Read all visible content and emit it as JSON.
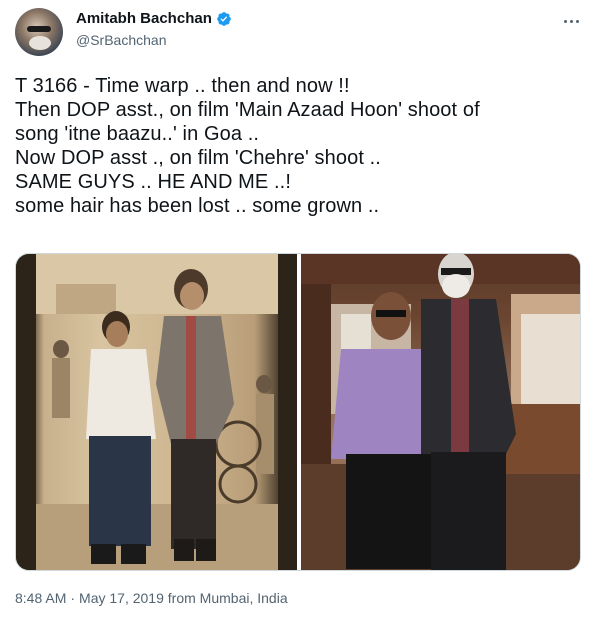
{
  "author": {
    "display_name": "Amitabh Bachchan",
    "handle": "@SrBachchan",
    "verified": true
  },
  "tweet": {
    "lines": [
      "T 3166 - Time warp .. then and now !!",
      "Then DOP asst., on film 'Main Azaad Hoon' shoot of",
      "song 'itne baazu..' in Goa ..",
      "Now DOP asst ., on film 'Chehre' shoot ..",
      "SAME GUYS .. HE AND ME ..!",
      "some hair has been lost .. some grown .."
    ]
  },
  "media": {
    "photos": [
      "vintage-photo",
      "recent-photo"
    ]
  },
  "meta": {
    "time": "8:48 AM",
    "separator": "·",
    "date": "May 17, 2019",
    "location_prefix": "from",
    "location": "Mumbai, India"
  },
  "colors": {
    "text": "#0f1419",
    "secondary": "#536471",
    "verified": "#1d9bf0",
    "border": "#cfd9de"
  },
  "icons": {
    "verified": "verified-badge-icon",
    "more": "more-options-icon"
  }
}
